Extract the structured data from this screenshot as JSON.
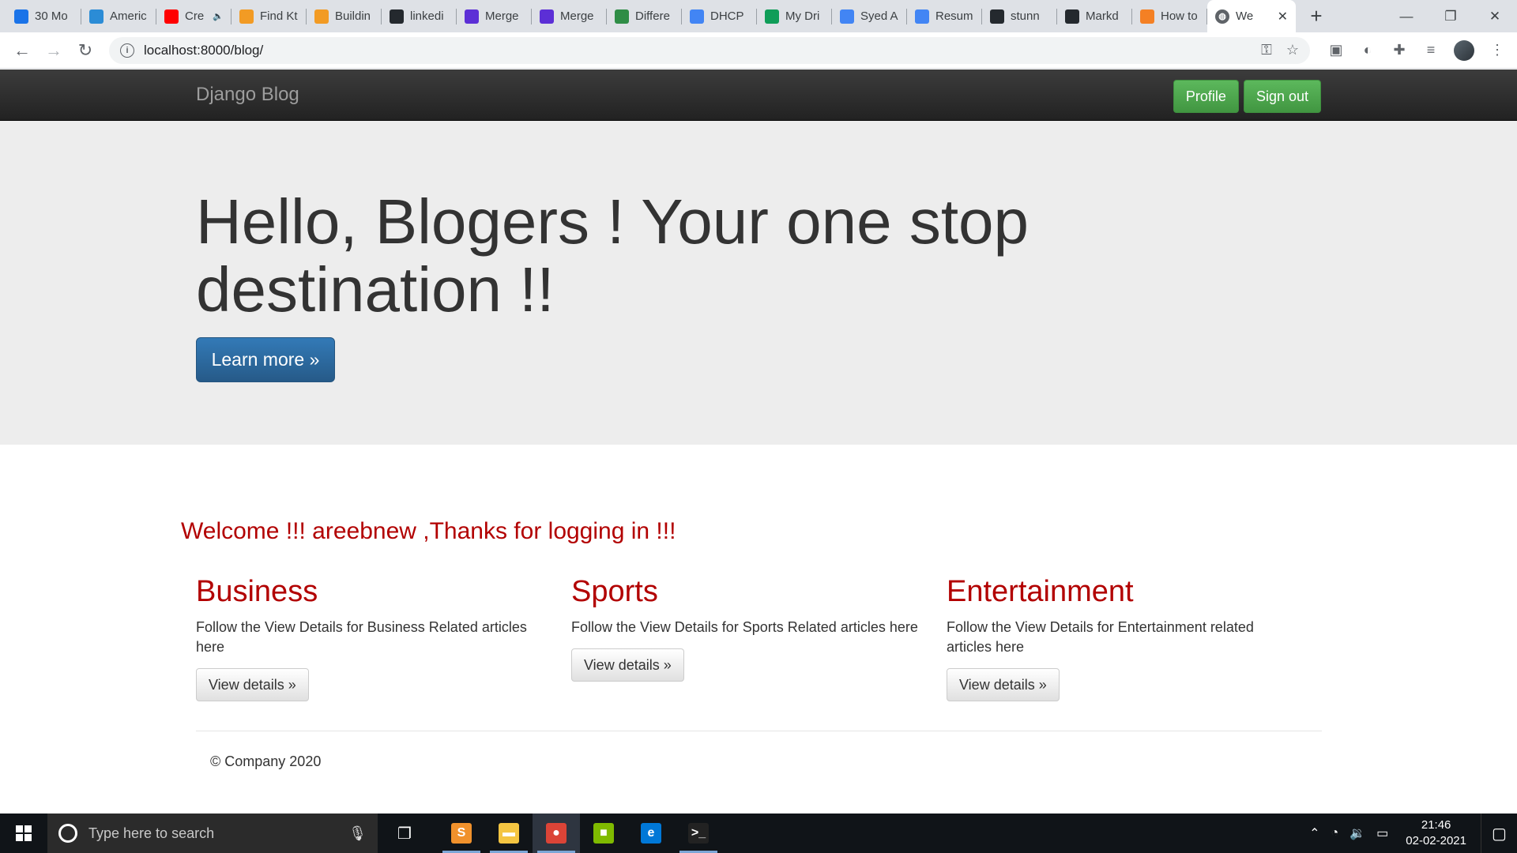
{
  "browser": {
    "tabs": [
      {
        "title": "30 Mo",
        "icon": "refresh-blue-icon",
        "color": "#1a73e8"
      },
      {
        "title": "Americ",
        "icon": "square-blue-icon",
        "color": "#2b8cd6"
      },
      {
        "title": "Cre",
        "icon": "youtube-icon",
        "color": "#ff0000",
        "muted": "🔈"
      },
      {
        "title": "Find Kt",
        "icon": "e-icon",
        "color": "#f29b24"
      },
      {
        "title": "Buildin",
        "icon": "e-icon",
        "color": "#f29b24"
      },
      {
        "title": "linkedi",
        "icon": "github-icon",
        "color": "#24292e"
      },
      {
        "title": "Merge",
        "icon": "m-icon",
        "color": "#5c2fd6"
      },
      {
        "title": "Merge",
        "icon": "m-icon",
        "color": "#5c2fd6"
      },
      {
        "title": "Differe",
        "icon": "gfg-icon",
        "color": "#2f8d46"
      },
      {
        "title": "DHCP",
        "icon": "google-icon",
        "color": "#4285f4"
      },
      {
        "title": "My Dri",
        "icon": "drive-icon",
        "color": "#0f9d58"
      },
      {
        "title": "Syed A",
        "icon": "docs-icon",
        "color": "#4285f4"
      },
      {
        "title": "Resum",
        "icon": "docs-icon",
        "color": "#4285f4"
      },
      {
        "title": "stunn",
        "icon": "github-icon",
        "color": "#24292e"
      },
      {
        "title": "Markd",
        "icon": "github-icon",
        "color": "#24292e"
      },
      {
        "title": "How to",
        "icon": "stackoverflow-icon",
        "color": "#f48024"
      }
    ],
    "active_tab": {
      "title": "We",
      "icon": "globe-icon"
    },
    "new_tab": "+",
    "window": {
      "minimize": "—",
      "restore": "❐",
      "close": "✕"
    },
    "url": "localhost:8000/blog/"
  },
  "page": {
    "brand": "Django Blog",
    "nav": {
      "profile": "Profile",
      "signout": "Sign out"
    },
    "jumbotron": {
      "heading": "Hello, Blogers ! Your one stop destination !!",
      "button": "Learn more »"
    },
    "welcome": "Welcome !!! areebnew ,Thanks for logging in !!!",
    "columns": [
      {
        "title": "Business",
        "text": "Follow the View Details for Business Related articles here",
        "button": "View details »"
      },
      {
        "title": "Sports",
        "text": "Follow the View Details for Sports Related articles here",
        "button": "View details »"
      },
      {
        "title": "Entertainment",
        "text": "Follow the View Details for Entertainment related articles here",
        "button": "View details »"
      }
    ],
    "footer": "© Company 2020"
  },
  "taskbar": {
    "search_placeholder": "Type here to search",
    "apps": [
      {
        "name": "sublime-text-icon",
        "glyph": "S",
        "color": "#f0912c",
        "open": true
      },
      {
        "name": "file-explorer-icon",
        "glyph": "▬",
        "color": "#f4c542",
        "open": true
      },
      {
        "name": "chrome-icon",
        "glyph": "●",
        "color": "#db4437",
        "open": true,
        "active": true
      },
      {
        "name": "windows-app-icon",
        "glyph": "■",
        "color": "#7fba00",
        "open": false
      },
      {
        "name": "edge-icon",
        "glyph": "e",
        "color": "#0078d7",
        "open": false
      },
      {
        "name": "terminal-icon",
        "glyph": ">_",
        "color": "#222",
        "open": true
      }
    ],
    "time": "21:46",
    "date": "02-02-2021"
  }
}
